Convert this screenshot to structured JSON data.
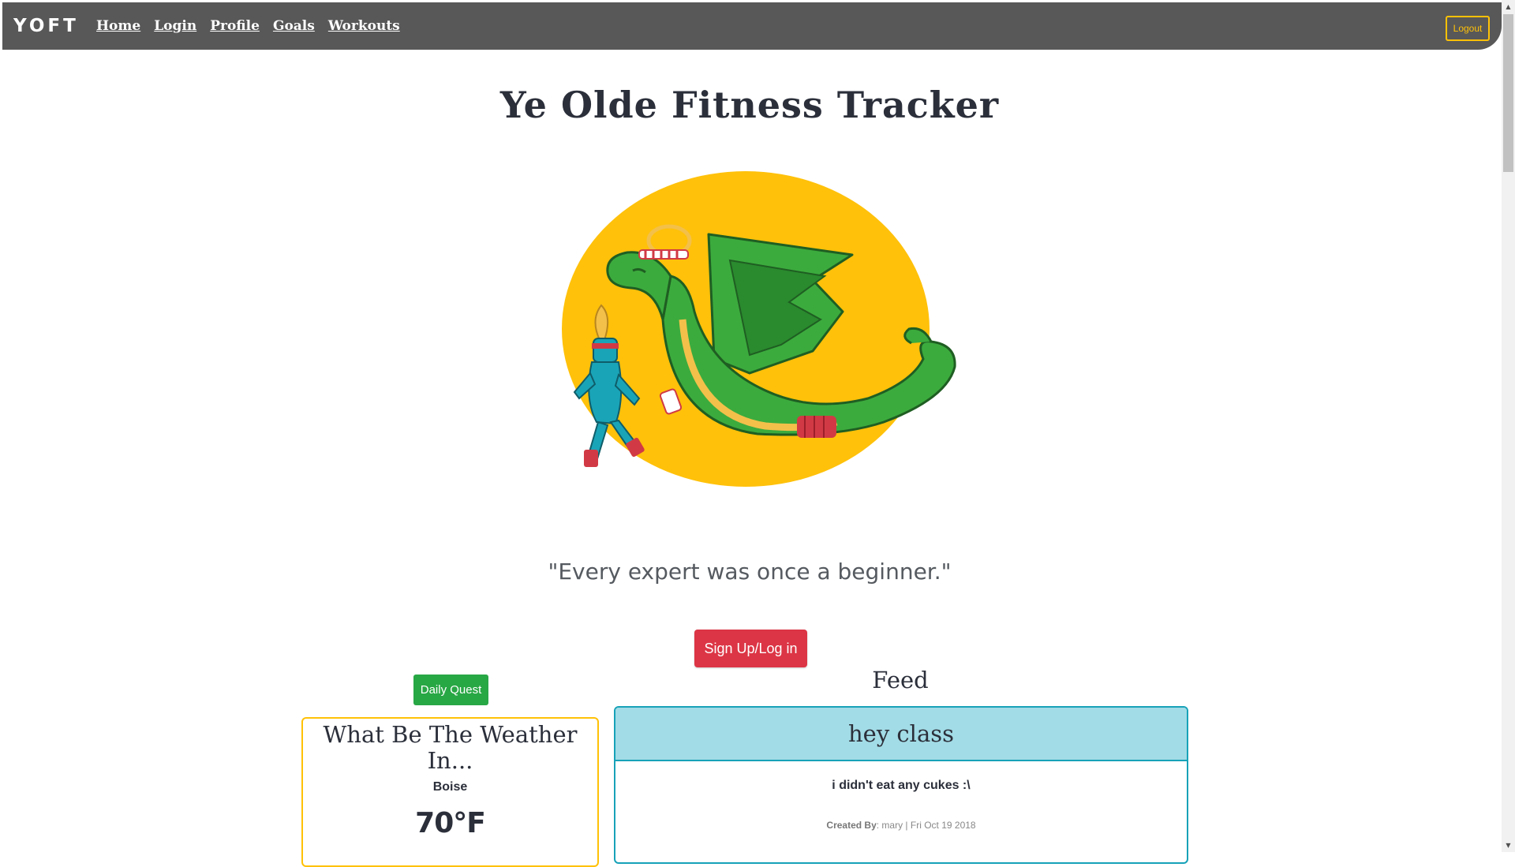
{
  "navbar": {
    "brand": "YOFT",
    "links": [
      "Home",
      "Login",
      "Profile",
      "Goals",
      "Workouts"
    ],
    "logout_label": "Logout"
  },
  "main": {
    "title": "Ye Olde Fitness Tracker",
    "hero_image": "dragon-and-knight-jogging-illustration",
    "quote": "\"Every expert was once a beginner.\"",
    "signup_label": "Sign Up/Log in",
    "daily_quest_label": "Daily Quest",
    "feed_heading": "Feed"
  },
  "weather": {
    "title": "What Be The Weather In...",
    "city": "Boise",
    "temperature": "70°F"
  },
  "feed": [
    {
      "title": "hey class",
      "body": "i didn't eat any cukes :\\",
      "created_by_label": "Created By",
      "meta": ": mary | Fri Oct 19 2018"
    }
  ],
  "colors": {
    "navbar": "#585858",
    "logout_accent": "#ffc107",
    "signup": "#dc3545",
    "daily_quest": "#28a745",
    "weather_border": "#ffc107",
    "feed_border": "#17a2b8",
    "feed_header": "#a2dce6",
    "hero_circle": "#ffc10a",
    "dragon": "#3bab3d"
  }
}
